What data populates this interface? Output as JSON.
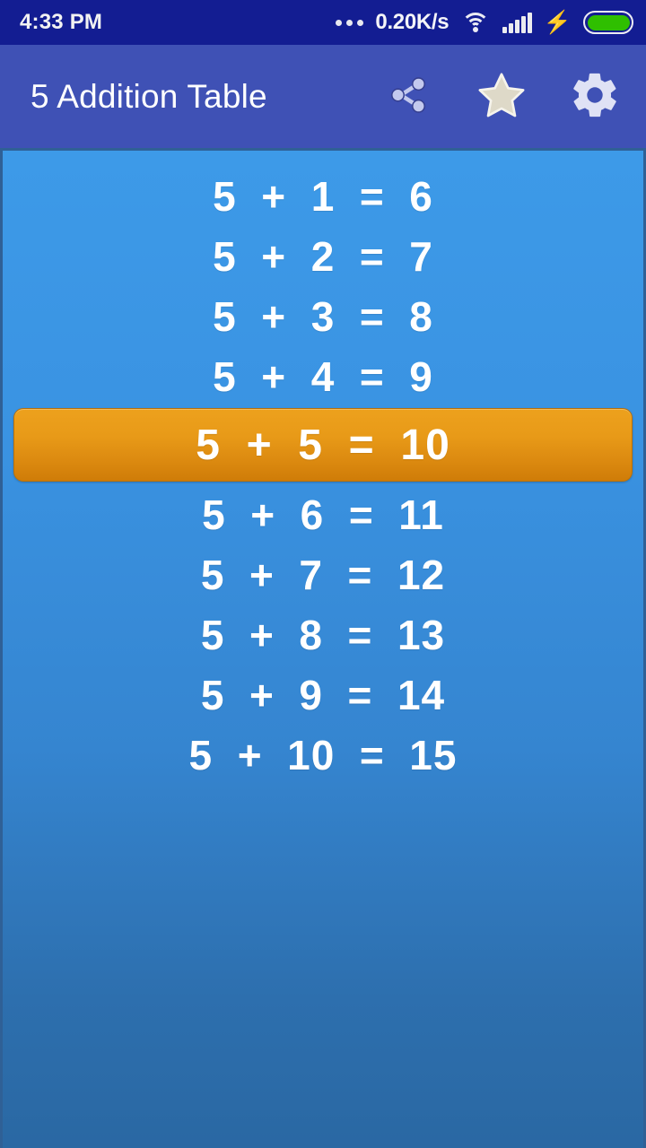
{
  "status_bar": {
    "time": "4:33 PM",
    "network_speed": "0.20K/s",
    "icons": {
      "more": "more-dots-icon",
      "wifi": "wifi-icon",
      "signal": "cellular-signal-icon",
      "charging": "charging-bolt-icon",
      "battery": "battery-full-icon"
    },
    "battery_level_percent": 100,
    "signal_bars": 5,
    "colors": {
      "background": "#131d92",
      "battery_fill": "#2fbf00",
      "text": "#ffffff"
    }
  },
  "app_bar": {
    "title": "5 Addition Table",
    "actions": [
      {
        "name": "share-button",
        "icon": "share-icon",
        "label": "Share"
      },
      {
        "name": "favorite-button",
        "icon": "star-icon",
        "label": "Favorite"
      },
      {
        "name": "settings-button",
        "icon": "gear-icon",
        "label": "Settings"
      }
    ],
    "colors": {
      "background": "#3f51b5",
      "title": "#ffffff"
    }
  },
  "table": {
    "base_number": 5,
    "operator": "+",
    "equals": "=",
    "highlighted_index": 4,
    "rows": [
      {
        "text": "5  +  1  =  6",
        "multiplier": 1,
        "result": 6,
        "highlighted": false
      },
      {
        "text": "5  +  2  =  7",
        "multiplier": 2,
        "result": 7,
        "highlighted": false
      },
      {
        "text": "5  +  3  =  8",
        "multiplier": 3,
        "result": 8,
        "highlighted": false
      },
      {
        "text": "5  +  4  =  9",
        "multiplier": 4,
        "result": 9,
        "highlighted": false
      },
      {
        "text": "5  +  5  =  10",
        "multiplier": 5,
        "result": 10,
        "highlighted": true
      },
      {
        "text": "5  +  6  =  11",
        "multiplier": 6,
        "result": 11,
        "highlighted": false
      },
      {
        "text": "5  +  7  =  12",
        "multiplier": 7,
        "result": 12,
        "highlighted": false
      },
      {
        "text": "5  +  8  =  13",
        "multiplier": 8,
        "result": 13,
        "highlighted": false
      },
      {
        "text": "5  +  9  =  14",
        "multiplier": 9,
        "result": 14,
        "highlighted": false
      },
      {
        "text": "5  +  10  =  15",
        "multiplier": 10,
        "result": 15,
        "highlighted": false
      }
    ],
    "colors": {
      "background_top": "#3d9ae8",
      "background_bottom": "#2a68a3",
      "row_text": "#ffffff",
      "highlight_top": "#eda11d",
      "highlight_bottom": "#cf7c08",
      "highlight_border": "#b8700a"
    }
  }
}
